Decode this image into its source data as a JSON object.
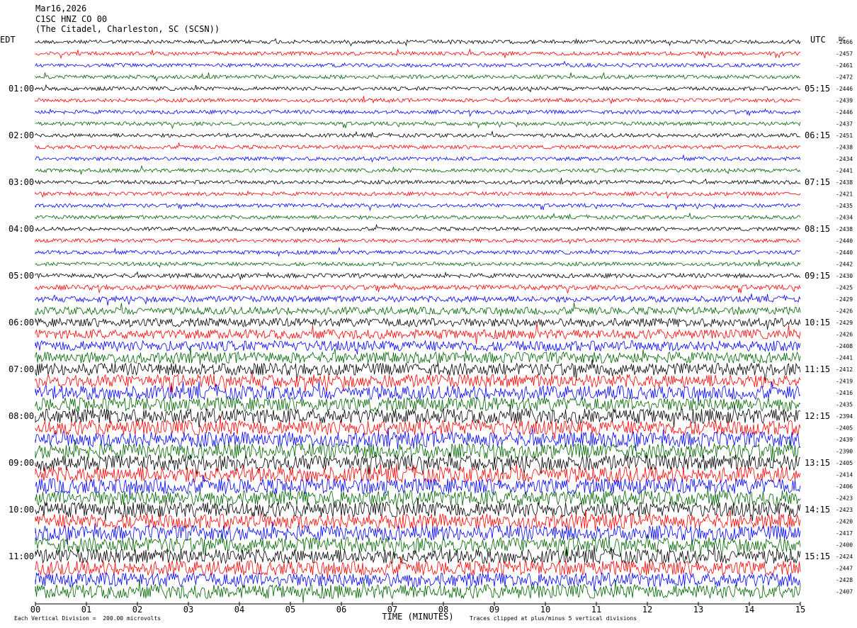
{
  "header": {
    "date": "Mar16,2026",
    "channel": "C1SC HNZ CO 00",
    "station": "(The Citadel, Charleston, SC (SCSN))"
  },
  "labels": {
    "left_tz": "EDT",
    "right_tz": "UTC",
    "dc_header": "DC"
  },
  "chart_data": {
    "type": "line",
    "title": "C1SC HNZ CO 00 (The Citadel, Charleston, SC (SCSN))",
    "xlabel": "TIME (MINUTES)",
    "xlim": [
      0,
      15
    ],
    "x_ticks": [
      "00",
      "01",
      "02",
      "03",
      "04",
      "05",
      "06",
      "07",
      "08",
      "09",
      "10",
      "11",
      "12",
      "13",
      "14",
      "15"
    ],
    "left_hour_labels": [
      "01:00",
      "02:00",
      "03:00",
      "04:00",
      "05:00",
      "06:00",
      "07:00",
      "08:00",
      "09:00",
      "10:00",
      "11:00"
    ],
    "right_hour_labels": [
      "05:15",
      "06:15",
      "07:15",
      "08:15",
      "09:15",
      "10:15",
      "11:15",
      "12:15",
      "13:15",
      "14:15",
      "15:15"
    ],
    "trace_colors": [
      "#000000",
      "#ff0000",
      "#0000ff",
      "#006400"
    ],
    "trace_count": 48,
    "traces_per_hour": 4,
    "dc_offsets": [
      -2466,
      -2457,
      -2461,
      -2472,
      -2446,
      -2439,
      -2446,
      -2437,
      -2451,
      -2438,
      -2434,
      -2441,
      -2438,
      -2421,
      -2435,
      -2434,
      -2438,
      -2440,
      -2440,
      -2442,
      -2430,
      -2425,
      -2429,
      -2426,
      -2429,
      -2426,
      -2408,
      -2441,
      -2412,
      -2419,
      -2416,
      -2435,
      -2394,
      -2405,
      -2439,
      -2390,
      -2405,
      -2414,
      -2406,
      -2423,
      -2423,
      -2420,
      -2417,
      -2400,
      -2424,
      -2447,
      -2428,
      -2407
    ],
    "noise_level": [
      1.0,
      1.0,
      1.0,
      1.0,
      1.0,
      1.0,
      1.0,
      1.0,
      1.0,
      1.0,
      1.0,
      1.0,
      1.0,
      1.0,
      1.0,
      1.0,
      1.0,
      1.0,
      1.0,
      1.0,
      1.2,
      1.3,
      1.6,
      2.0,
      2.3,
      2.5,
      2.8,
      3.0,
      3.3,
      3.5,
      3.7,
      3.8,
      4.0,
      4.0,
      4.1,
      4.1,
      4.2,
      4.2,
      4.2,
      4.1,
      4.1,
      4.0,
      4.0,
      4.0,
      3.9,
      3.9,
      3.8,
      3.8
    ],
    "scale_note": "Each Vertical Division =  200.00 microvolts",
    "clip_note": "Traces clipped at plus/minus 5 vertical divisions"
  }
}
